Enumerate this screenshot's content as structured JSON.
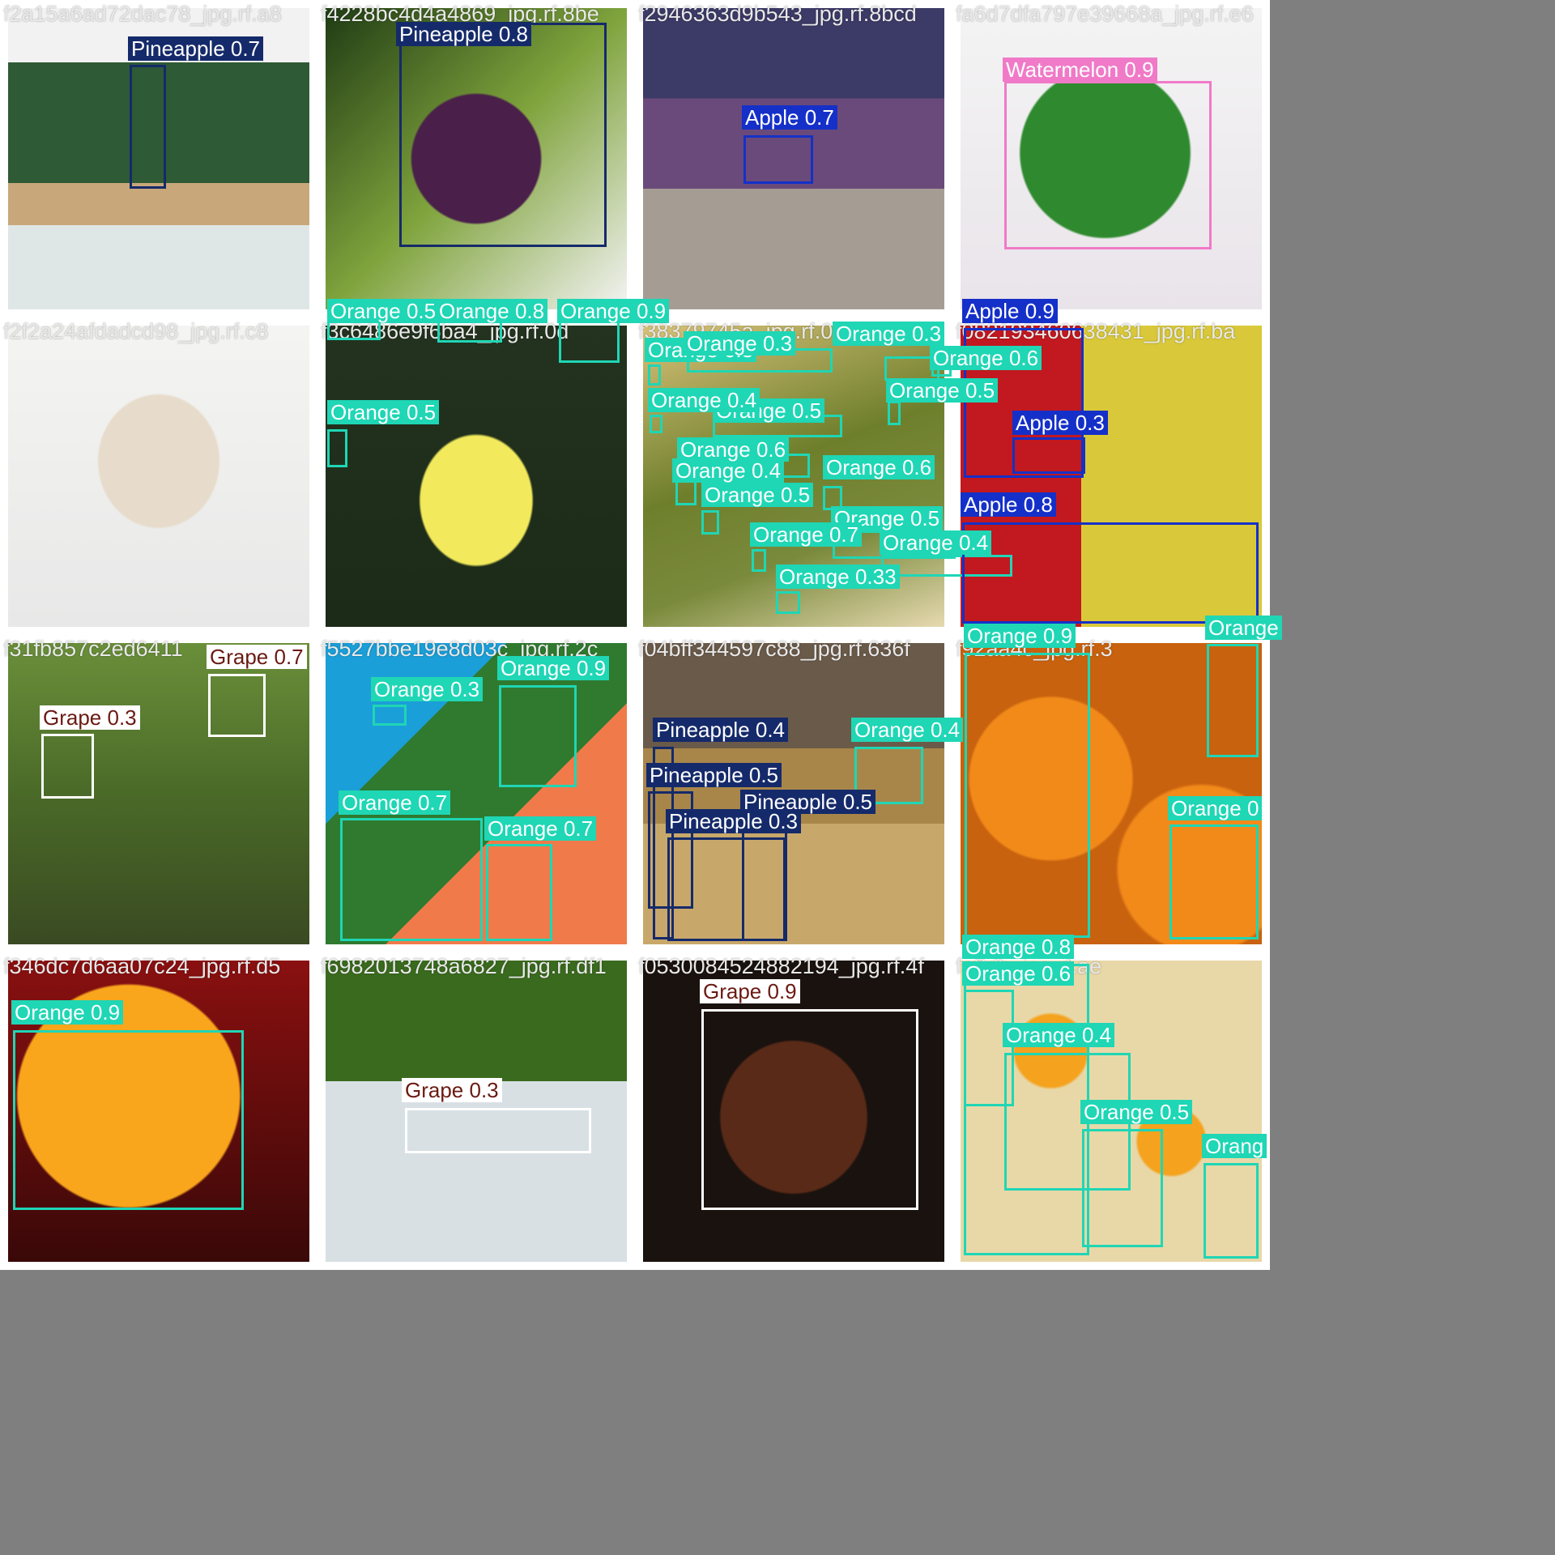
{
  "colors": {
    "Pineapple": "#152a6a",
    "Apple": "#1530c8",
    "Watermelon": "#f07ac8",
    "Orange": "#1fd6b5",
    "Grape": "#ffffff",
    "background": "#7f7f7f"
  },
  "tiles": [
    {
      "id": "t0",
      "filename": "f2a15a6ad72dac78_jpg.rf.a8",
      "detections": [
        {
          "cls": "Pineapple",
          "label": "Pineapple 0.7"
        }
      ]
    },
    {
      "id": "t1",
      "filename": "f4228bc4d4a4869_jpg.rf.8be",
      "detections": [
        {
          "cls": "Pineapple",
          "label": "Pineapple 0.8"
        }
      ]
    },
    {
      "id": "t2",
      "filename": "f2946363d9b543_jpg.rf.8bcd",
      "detections": [
        {
          "cls": "Apple",
          "label": "Apple 0.7"
        }
      ]
    },
    {
      "id": "t3",
      "filename": "fa6d7dfa797e39668a_jpg.rf.e6",
      "detections": [
        {
          "cls": "Watermelon",
          "label": "Watermelon 0.9"
        }
      ]
    },
    {
      "id": "t4",
      "filename": "f2f2a24afdadcd98_jpg.rf.c8",
      "detections": []
    },
    {
      "id": "t5",
      "filename": "f3c6486e9f6ba4_jpg.rf.0d",
      "detections": [
        {
          "cls": "Orange",
          "label": "Orange 0.5"
        },
        {
          "cls": "Orange",
          "label": "Orange 0.8"
        },
        {
          "cls": "Orange",
          "label": "Orange 0.9"
        },
        {
          "cls": "Orange",
          "label": "Orange 0.5"
        }
      ]
    },
    {
      "id": "t6",
      "filename": "f38379745a_jpg.rf.0",
      "detections": [
        {
          "cls": "Orange",
          "label": "Orange 0.3"
        },
        {
          "cls": "Orange",
          "label": "Orange 0.3"
        },
        {
          "cls": "Orange",
          "label": "Orange 0.3"
        },
        {
          "cls": "Orange",
          "label": "Orange 0.6"
        },
        {
          "cls": "Orange",
          "label": "Orange 0.5"
        },
        {
          "cls": "Orange",
          "label": "Orange 0.5"
        },
        {
          "cls": "Orange",
          "label": "Orange 0.6"
        },
        {
          "cls": "Orange",
          "label": "Orange 0.4"
        },
        {
          "cls": "Orange",
          "label": "Orange 0.6"
        },
        {
          "cls": "Orange",
          "label": "Orange 0.5"
        },
        {
          "cls": "Orange",
          "label": "Orange 0.5"
        },
        {
          "cls": "Orange",
          "label": "Orange 0.7"
        },
        {
          "cls": "Orange",
          "label": "Orange 0.4"
        },
        {
          "cls": "Orange",
          "label": "Orange 0.33"
        },
        {
          "cls": "Orange",
          "label": "Orange 0.4"
        }
      ]
    },
    {
      "id": "t7",
      "filename": "f082193460638431_jpg.rf.ba",
      "detections": [
        {
          "cls": "Apple",
          "label": "Apple 0.9"
        },
        {
          "cls": "Apple",
          "label": "Apple 0.3"
        },
        {
          "cls": "Apple",
          "label": "Apple 0.8"
        }
      ]
    },
    {
      "id": "t8",
      "filename": "f31fb857c2ed6411",
      "detections": [
        {
          "cls": "Grape",
          "label": "Grape 0.7"
        },
        {
          "cls": "Grape",
          "label": "Grape 0.3"
        }
      ]
    },
    {
      "id": "t9",
      "filename": "f5527bbe19e8d03c_jpg.rf.2c",
      "detections": [
        {
          "cls": "Orange",
          "label": "Orange 0.9"
        },
        {
          "cls": "Orange",
          "label": "Orange 0.3"
        },
        {
          "cls": "Orange",
          "label": "Orange 0.7"
        },
        {
          "cls": "Orange",
          "label": "Orange 0.7"
        }
      ]
    },
    {
      "id": "t10",
      "filename": "f04bff344597c88_jpg.rf.636f",
      "detections": [
        {
          "cls": "Pineapple",
          "label": "Pineapple 0.4"
        },
        {
          "cls": "Orange",
          "label": "Orange 0.4"
        },
        {
          "cls": "Pineapple",
          "label": "Pineapple 0.5"
        },
        {
          "cls": "Pineapple",
          "label": "Pineapple 0.5"
        },
        {
          "cls": "Pineapple",
          "label": "Pineapple 0.3"
        }
      ]
    },
    {
      "id": "t11",
      "filename": "f92aa4c_jpg.rf.3",
      "detections": [
        {
          "cls": "Orange",
          "label": "Orange 0.9"
        },
        {
          "cls": "Orange",
          "label": "Orange"
        },
        {
          "cls": "Orange",
          "label": "Orange 0"
        }
      ]
    },
    {
      "id": "t12",
      "filename": "f346dc7d6aa07c24_jpg.rf.d5",
      "detections": [
        {
          "cls": "Orange",
          "label": "Orange 0.9"
        }
      ]
    },
    {
      "id": "t13",
      "filename": "f6982013748a6827_jpg.rf.df1",
      "detections": [
        {
          "cls": "Grape",
          "label": "Grape 0.3"
        }
      ]
    },
    {
      "id": "t14",
      "filename": "f0530084524882194_jpg.rf.4f",
      "detections": [
        {
          "cls": "Grape",
          "label": "Grape 0.9"
        }
      ]
    },
    {
      "id": "t15",
      "filename": "fa8db_jpg.rf.ae",
      "detections": [
        {
          "cls": "Orange",
          "label": "Orange 0.8"
        },
        {
          "cls": "Orange",
          "label": "Orange 0.6"
        },
        {
          "cls": "Orange",
          "label": "Orange 0.4"
        },
        {
          "cls": "Orange",
          "label": "Orange 0.5"
        },
        {
          "cls": "Orange",
          "label": "Orang"
        }
      ]
    }
  ]
}
